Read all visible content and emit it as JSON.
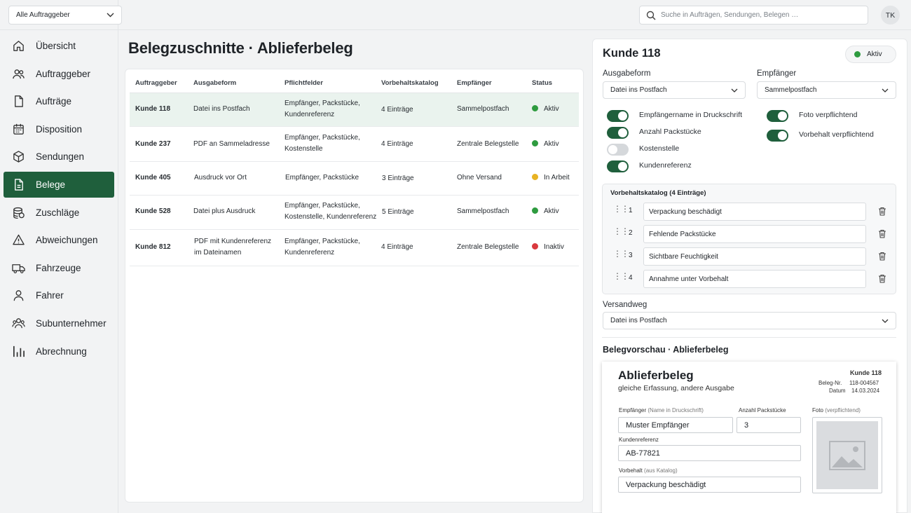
{
  "client_filter": "Alle Auftraggeber",
  "search": {
    "placeholder": "Suche in Aufträgen, Sendungen, Belegen …"
  },
  "user_initials": "TK",
  "nav": [
    {
      "label": "Übersicht",
      "icon": "home-icon"
    },
    {
      "label": "Auftraggeber",
      "icon": "users-icon"
    },
    {
      "label": "Aufträge",
      "icon": "document-icon"
    },
    {
      "label": "Disposition",
      "icon": "calendar-icon"
    },
    {
      "label": "Sendungen",
      "icon": "package-icon"
    },
    {
      "label": "Belege",
      "icon": "receipt-icon"
    },
    {
      "label": "Zuschläge",
      "icon": "coins-icon"
    },
    {
      "label": "Abweichungen",
      "icon": "warning-icon"
    },
    {
      "label": "Fahrzeuge",
      "icon": "truck-icon"
    },
    {
      "label": "Fahrer",
      "icon": "user-icon"
    },
    {
      "label": "Subunternehmer",
      "icon": "group-icon"
    },
    {
      "label": "Abrechnung",
      "icon": "bar-chart-icon"
    }
  ],
  "page_title": "Belegzuschnitte · Ablieferbeleg",
  "table": {
    "headers": [
      "Auftraggeber",
      "Ausgabeform",
      "Pflichtfelder",
      "Vorbehaltskatalog",
      "Empfänger",
      "Status"
    ],
    "rows": [
      {
        "client": "Kunde 118",
        "form": "Datei ins Postfach",
        "fields": "Empfänger, Packstücke,\nKundenreferenz",
        "catalog": "4 Einträge",
        "recipient": "Sammelpostfach",
        "status": "Aktiv",
        "status_color": "#2e9b3f"
      },
      {
        "client": "Kunde 237",
        "form": "PDF an Sammeladresse",
        "fields": "Empfänger, Packstücke,\nKostenstelle",
        "catalog": "4 Einträge",
        "recipient": "Zentrale Belegstelle",
        "status": "Aktiv",
        "status_color": "#2e9b3f"
      },
      {
        "client": "Kunde 405",
        "form": "Ausdruck vor Ort",
        "fields": "Empfänger, Packstücke",
        "catalog": "3 Einträge",
        "recipient": "Ohne Versand",
        "status": "In Arbeit",
        "status_color": "#e8b323"
      },
      {
        "client": "Kunde 528",
        "form": "Datei plus Ausdruck",
        "fields": "Empfänger, Packstücke,\nKostenstelle, Kundenreferenz",
        "catalog": "5 Einträge",
        "recipient": "Sammelpostfach",
        "status": "Aktiv",
        "status_color": "#2e9b3f"
      },
      {
        "client": "Kunde 812",
        "form": "PDF mit Kundenreferenz\nim Dateinamen",
        "fields": "Empfänger, Packstücke,\nKundenreferenz",
        "catalog": "4 Einträge",
        "recipient": "Zentrale Belegstelle",
        "status": "Inaktiv",
        "status_color": "#d9393e"
      }
    ]
  },
  "detail": {
    "title": "Kunde 118",
    "status": "Aktiv",
    "output_label": "Ausgabeform",
    "output_value": "Datei ins Postfach",
    "recipient_label": "Empfänger",
    "recipient_value": "Sammelpostfach",
    "toggles_left": [
      {
        "label": "Empfängername in Druckschrift",
        "on": true
      },
      {
        "label": "Anzahl Packstücke",
        "on": true
      },
      {
        "label": "Kostenstelle",
        "on": false
      },
      {
        "label": "Kundenreferenz",
        "on": true
      }
    ],
    "toggles_right": [
      {
        "label": "Foto verpflichtend",
        "on": true
      },
      {
        "label": "Vorbehalt verpflichtend",
        "on": true
      }
    ],
    "catalog_title": "Vorbehaltskatalog (4 Einträge)",
    "catalog": [
      {
        "num": "1",
        "text": "Verpackung beschädigt"
      },
      {
        "num": "2",
        "text": "Fehlende Packstücke"
      },
      {
        "num": "3",
        "text": "Sichtbare Feuchtigkeit"
      },
      {
        "num": "4",
        "text": "Annahme unter Vorbehalt"
      }
    ],
    "ship_label": "Versandweg",
    "ship_value": "Datei ins Postfach",
    "preview_title": "Belegvorschau · Ablieferbeleg"
  },
  "doc": {
    "title": "Ablieferbeleg",
    "subtitle": "gleiche Erfassung, andere Ausgabe",
    "client": "Kunde 118",
    "number_label": "Beleg-Nr.",
    "number": "118-004567",
    "date_label": "Datum",
    "date": "14.03.2024",
    "recipient_label": "Empfänger",
    "recipient_hint": "(Name in Druckschrift)",
    "recipient_value": "Muster Empfänger",
    "count_label": "Anzahl Packstücke",
    "count_value": "3",
    "photo_label": "Foto",
    "photo_hint": "(verpflichtend)",
    "ref_label": "Kundenreferenz",
    "ref_value": "AB-77821",
    "reserve_label": "Vorbehalt",
    "reserve_hint": "(aus Katalog)",
    "reserve_value": "Verpackung beschädigt"
  }
}
